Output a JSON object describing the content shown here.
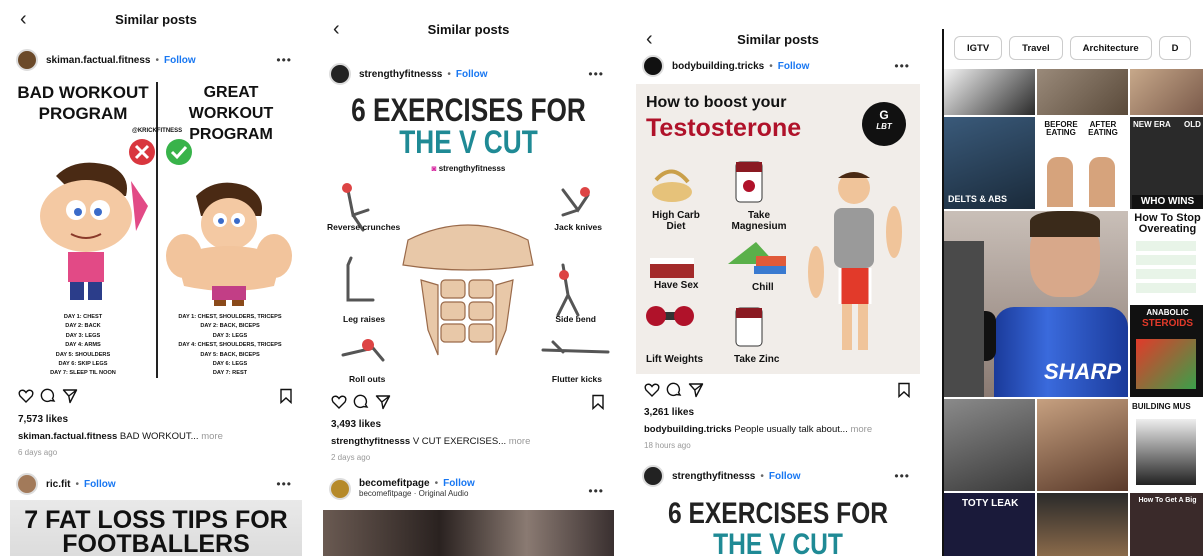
{
  "panels": [
    {
      "header": "Similar posts",
      "post": {
        "username": "skiman.factual.fitness",
        "follow": "Follow",
        "image": {
          "left_title": "BAD WORKOUT PROGRAM",
          "right_title": "GREAT WORKOUT PROGRAM",
          "watermark": "@KRICKFITNESS",
          "left_days": [
            "DAY 1: CHEST",
            "DAY 2: BACK",
            "DAY 3: LEGS",
            "DAY 4: ARMS",
            "DAY 5: SHOULDERS",
            "DAY 6: SKIP LEGS",
            "DAY 7: SLEEP TIL NOON"
          ],
          "right_days": [
            "DAY 1: CHEST, SHOULDERS, TRICEPS",
            "DAY 2: BACK, BICEPS",
            "DAY 3: LEGS",
            "DAY 4: CHEST, SHOULDERS, TRICEPS",
            "DAY 5: BACK, BICEPS",
            "DAY 6: LEGS",
            "DAY 7: REST"
          ]
        },
        "likes": "7,573 likes",
        "caption_user": "skiman.factual.fitness",
        "caption_text": "BAD WORKOUT...",
        "more": "more",
        "time": "6 days ago"
      },
      "next": {
        "username": "ric.fit",
        "follow": "Follow",
        "preview_title": "7 FAT LOSS TIPS FOR FOOTBALLERS"
      }
    },
    {
      "header": "Similar posts",
      "post": {
        "username": "strengthyfitnesss",
        "follow": "Follow",
        "image": {
          "title_line1": "6 EXERCISES FOR",
          "title_line2": "THE V CUT",
          "handle": "strengthyfitnesss",
          "exercises": [
            "Reverse crunches",
            "Jack knives",
            "Leg raises",
            "Side bend",
            "Roll outs",
            "Flutter kicks"
          ]
        },
        "likes": "3,493 likes",
        "caption_user": "strengthyfitnesss",
        "caption_text": "V CUT EXERCISES...",
        "more": "more",
        "time": "2 days ago"
      },
      "next": {
        "username": "becomefitpage",
        "follow": "Follow",
        "subtitle": "becomefitpage · Original Audio"
      }
    },
    {
      "header": "Similar posts",
      "post": {
        "username": "bodybuilding.tricks",
        "follow": "Follow",
        "image": {
          "title_line1": "How to boost your",
          "title_line2": "Testosterone",
          "badge_top": "G",
          "badge_bottom": "LBT",
          "tips": [
            "High Carb Diet",
            "Take Magnesium",
            "Have Sex",
            "Chill",
            "Lift Weights",
            "Take Zinc"
          ]
        },
        "likes": "3,261 likes",
        "caption_user": "bodybuilding.tricks",
        "caption_text": "People usually talk about...",
        "more": "more",
        "time": "18 hours ago"
      },
      "next": {
        "username": "strengthyfitnesss",
        "follow": "Follow",
        "preview_title": "6 EXERCISES FOR THE V CUT"
      }
    }
  ],
  "explore": {
    "tabs": [
      "IGTV",
      "Travel",
      "Architecture",
      "D"
    ],
    "tile_texts": {
      "delts": "DELTS & ABS",
      "before": "BEFORE EATING",
      "after": "AFTER EATING",
      "newera": "NEW ERA",
      "old": "OLD",
      "whowins": "WHO WINS",
      "overeat": "How To Stop Overeating",
      "anabolic": "ANABOLIC",
      "steroids": "STEROIDS",
      "sharp": "SHARP",
      "buildmus": "BUILDING MUS",
      "toty": "TOTY LEAK",
      "getbig": "How To Get A Big"
    }
  },
  "colors": {
    "follow": "#1877f2",
    "accent_red": "#b0122a",
    "teal": "#1f8a95"
  }
}
